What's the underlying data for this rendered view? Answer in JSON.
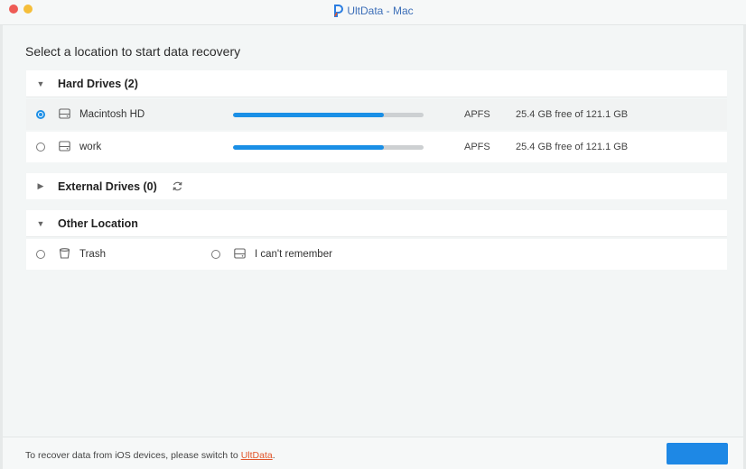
{
  "window": {
    "title": "UltData - Mac",
    "logo_icon": "ultdata-logo-icon",
    "controls": [
      "close",
      "minimize"
    ]
  },
  "heading": "Select a location to start data recovery",
  "sections": {
    "hard_drives": {
      "title": "Hard Drives (2)",
      "expanded": true,
      "drives": [
        {
          "name": "Macintosh HD",
          "filesystem": "APFS",
          "space": "25.4 GB free of 121.1 GB",
          "usage": 0.79,
          "selected": true
        },
        {
          "name": "work",
          "filesystem": "APFS",
          "space": "25.4 GB free of 121.1 GB",
          "usage": 0.79,
          "selected": false
        }
      ]
    },
    "external_drives": {
      "title": "External Drives (0)",
      "expanded": false,
      "refresh_icon": "refresh-icon"
    },
    "other_location": {
      "title": "Other Location",
      "expanded": true,
      "options": [
        {
          "name": "Trash",
          "icon": "trash-icon"
        },
        {
          "name": "I can't remember",
          "icon": "drive-icon"
        }
      ]
    }
  },
  "footer": {
    "text": "To recover data from iOS devices, please switch to ",
    "link": "UltData",
    "suffix": "."
  },
  "colors": {
    "accent": "#1a8fe6",
    "link": "#e2552a",
    "close": "#ee5b55",
    "minimize": "#f5be3a"
  }
}
